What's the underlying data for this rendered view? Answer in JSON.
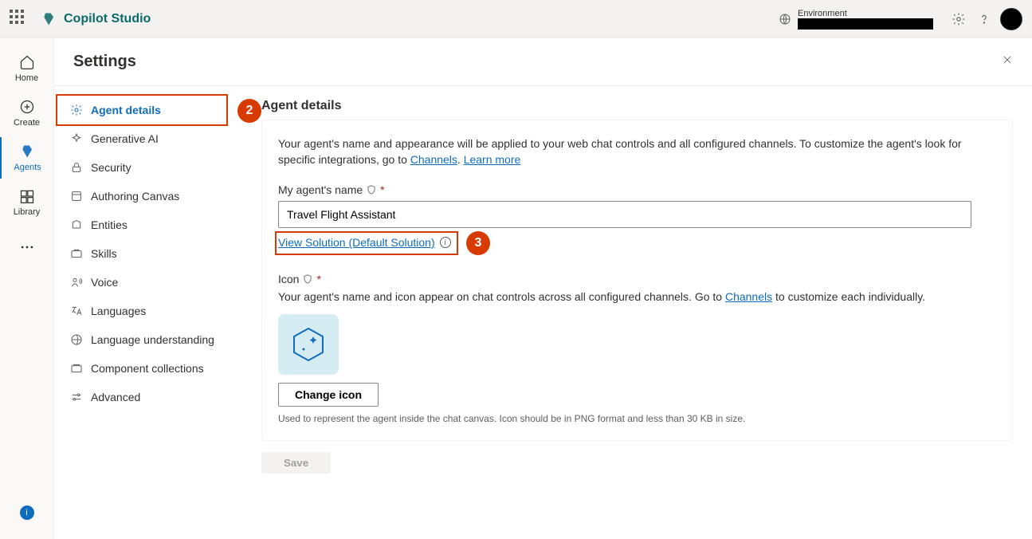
{
  "app": {
    "name": "Copilot Studio"
  },
  "topbar": {
    "env_label": "Environment",
    "env_value": "████████"
  },
  "rail": {
    "home": "Home",
    "create": "Create",
    "agents": "Agents",
    "library": "Library"
  },
  "page": {
    "title": "Settings"
  },
  "settings_nav": {
    "agent_details": "Agent details",
    "generative_ai": "Generative AI",
    "security": "Security",
    "authoring_canvas": "Authoring Canvas",
    "entities": "Entities",
    "skills": "Skills",
    "voice": "Voice",
    "languages": "Languages",
    "language_understanding": "Language understanding",
    "component_collections": "Component collections",
    "advanced": "Advanced"
  },
  "details": {
    "heading": "Agent details",
    "desc_pre": "Your agent's name and appearance will be applied to your web chat controls and all configured channels. To customize the agent's look for specific integrations, go to ",
    "channels_link": "Channels",
    "desc_sep": ". ",
    "learn_more": "Learn more",
    "name_label": "My agent's name",
    "name_value": "Travel Flight Assistant",
    "view_solution": "View Solution (Default Solution)",
    "icon_label": "Icon",
    "icon_desc_pre": "Your agent's name and icon appear on chat controls across all configured channels. Go to ",
    "icon_desc_post": " to customize each individually.",
    "change_icon": "Change icon",
    "icon_hint": "Used to represent the agent inside the chat canvas. Icon should be in PNG format and less than 30 KB in size.",
    "save": "Save"
  },
  "annotations": {
    "two": "2",
    "three": "3"
  }
}
